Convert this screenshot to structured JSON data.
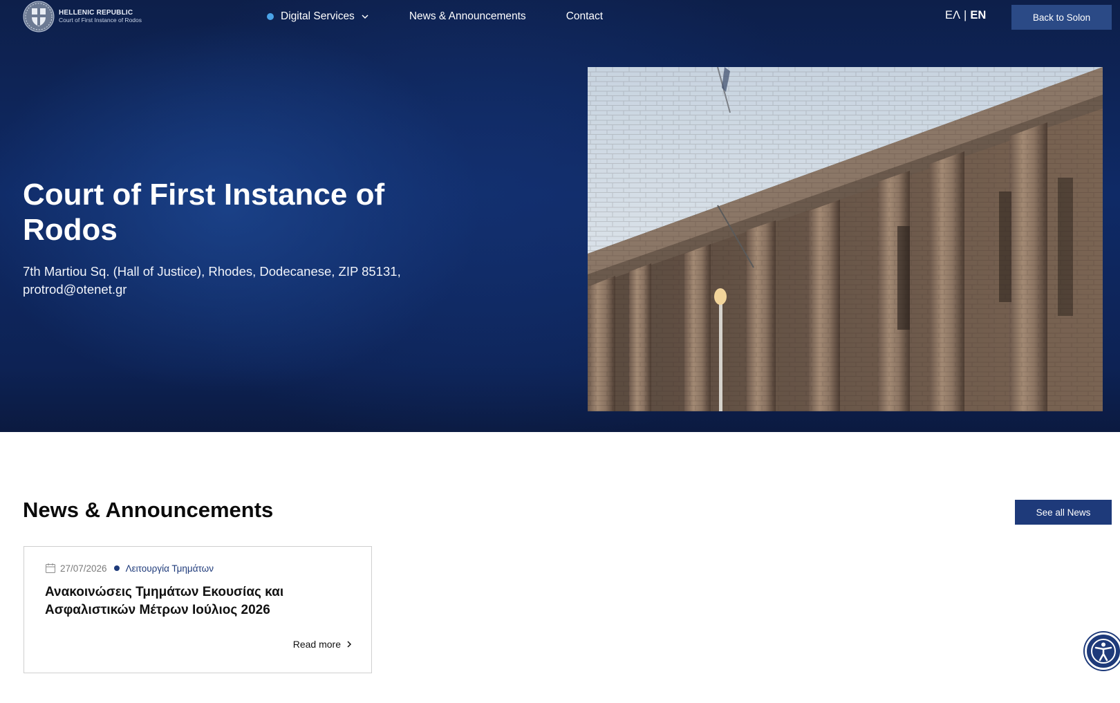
{
  "header": {
    "logo": {
      "line1": "HELLENIC REPUBLIC",
      "line2": "Court of First Instance of Rodos"
    },
    "nav": {
      "services": "Digital Services",
      "news": "News & Announcements",
      "contact": "Contact"
    },
    "lang": {
      "el": "ΕΛ",
      "separator": "|",
      "en": "EN"
    },
    "back_button": "Back to Solon"
  },
  "hero": {
    "title": "Court of First Instance of Rodos",
    "address": "7th Martiou Sq. (Hall of Justice), Rhodes, Dodecanese, ZIP 85131,",
    "email": "protrod@otenet.gr"
  },
  "news": {
    "heading": "News & Announcements",
    "see_all": "See all News",
    "items": [
      {
        "date": "27/07/2026",
        "category": "Λειτουργία Τμημάτων",
        "title": "Ανακοινώσεις Τμημάτων Εκουσίας και Ασφαλιστικών Μέτρων Ιούλιος 2026",
        "read_more": "Read more"
      }
    ]
  },
  "colors": {
    "hero_bg": "#0f2a66",
    "accent_dot": "#4aa3e8",
    "primary": "#1e3a7a",
    "back_button_bg": "#2b4a86"
  }
}
